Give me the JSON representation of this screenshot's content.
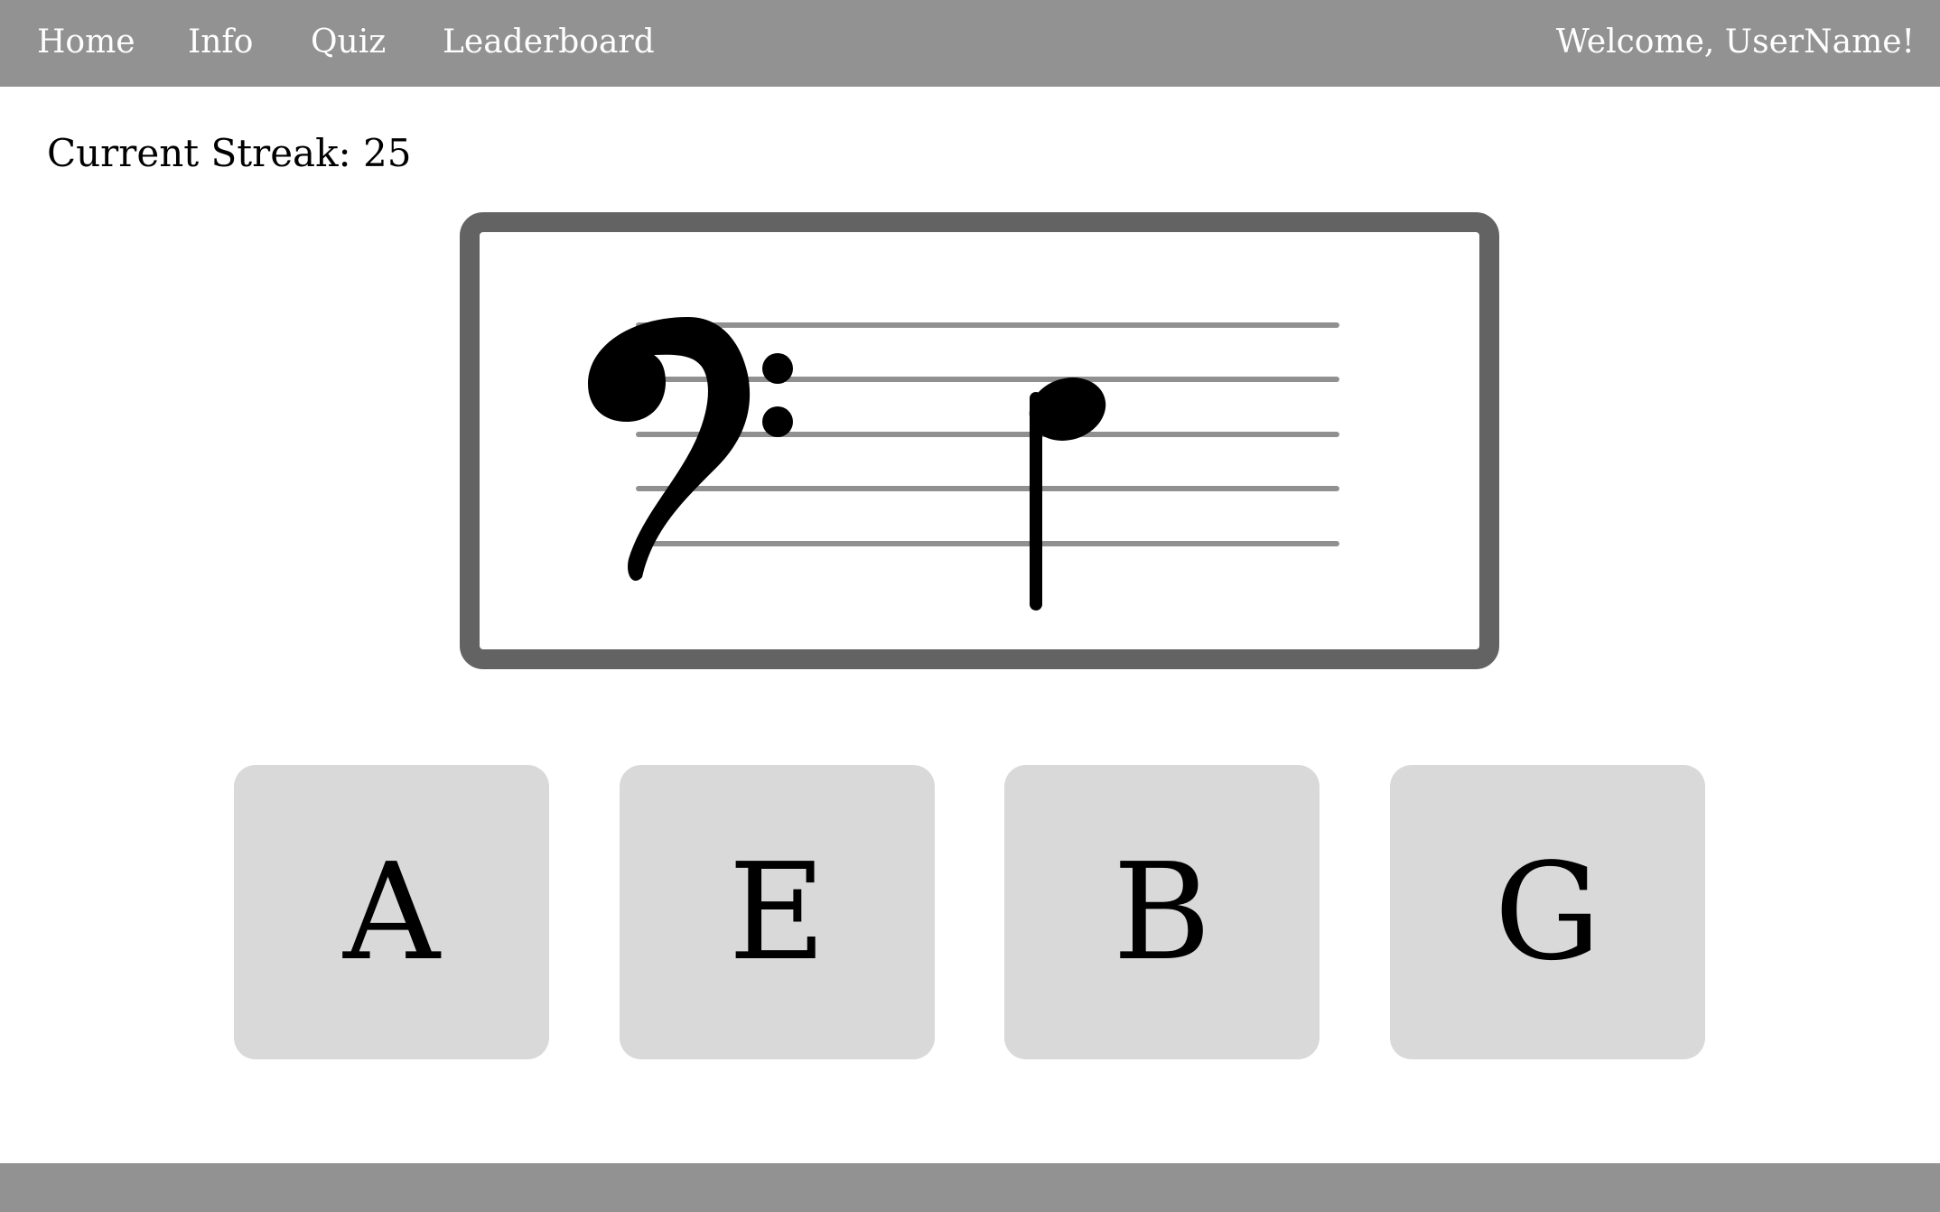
{
  "nav": {
    "items": [
      {
        "label": "Home"
      },
      {
        "label": "Info"
      },
      {
        "label": "Quiz"
      },
      {
        "label": "Leaderboard"
      }
    ],
    "welcome": "Welcome, UserName!"
  },
  "streak": {
    "label": "Current Streak: 25"
  },
  "staff": {
    "clef": "bass-clef-icon",
    "note": "quarter-note-icon"
  },
  "answers": [
    {
      "label": "A"
    },
    {
      "label": "E"
    },
    {
      "label": "B"
    },
    {
      "label": "G"
    }
  ],
  "colors": {
    "topbar": "#929292",
    "footer": "#929292",
    "card_border": "#636363",
    "staff_lines": "#909090",
    "button_bg": "#d9d9d9",
    "text_dark": "#000000",
    "text_light": "#ffffff"
  }
}
